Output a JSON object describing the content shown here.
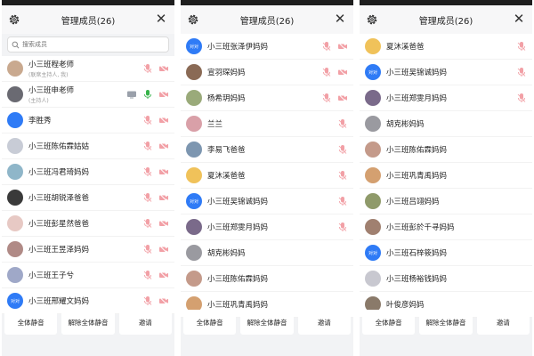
{
  "colors": {
    "muted_mic": "#f2a0a6",
    "active_mic": "#37b34a",
    "camera_off": "#f2a0a6",
    "brand_blue": "#2f7bf6"
  },
  "panels": [
    {
      "title": "管理成员(26)",
      "search_placeholder": "搜索成员",
      "members": [
        {
          "name": "小三班程老师",
          "sub": "(联席主持人, 我)",
          "avatar": "photo",
          "avatar_color": "#c9a98f",
          "mic": "muted",
          "cam": "off"
        },
        {
          "name": "小三班申老师",
          "sub": "(主持人)",
          "avatar": "photo",
          "avatar_color": "#6a6a72",
          "mic": "active",
          "cam": "off",
          "screen": "screen-share-icon"
        },
        {
          "name": "李胜秀",
          "avatar": "text",
          "avatar_text": "",
          "avatar_color": "#2f7bf6",
          "mic": "muted",
          "cam": "off"
        },
        {
          "name": "小三班陈佑霖姑姑",
          "avatar": "photo",
          "avatar_color": "#c8ccd6",
          "mic": "muted",
          "cam": "off"
        },
        {
          "name": "小三班冯君琦妈妈",
          "avatar": "photo",
          "avatar_color": "#8fb6c9",
          "mic": "muted",
          "cam": "off"
        },
        {
          "name": "小三班胡锐泽爸爸",
          "avatar": "photo",
          "avatar_color": "#3a3a3a",
          "mic": "muted",
          "cam": "off"
        },
        {
          "name": "小三班彭星然爸爸",
          "avatar": "photo",
          "avatar_color": "#e7c9c4",
          "mic": "muted",
          "cam": "off"
        },
        {
          "name": "小三班王昱泽妈妈",
          "avatar": "photo",
          "avatar_color": "#b08a86",
          "mic": "muted",
          "cam": "off"
        },
        {
          "name": "小三班王子兮",
          "avatar": "photo",
          "avatar_color": "#9fa8c8",
          "mic": "muted",
          "cam": "off"
        },
        {
          "name": "小三班邢耀文妈妈",
          "avatar": "text",
          "avatar_text": "对对",
          "avatar_color": "#2f7bf6",
          "mic": "muted",
          "cam": "off"
        }
      ],
      "buttons": [
        "全体静音",
        "解除全体静音",
        "邀请"
      ]
    },
    {
      "title": "管理成员(26)",
      "members": [
        {
          "name": "小三班张泽伊妈妈",
          "avatar": "text",
          "avatar_text": "对对",
          "avatar_color": "#2f7bf6",
          "mic": "muted",
          "cam": "off"
        },
        {
          "name": "宣羽琛妈妈",
          "avatar": "photo",
          "avatar_color": "#8a6a55",
          "mic": "muted",
          "cam": "off"
        },
        {
          "name": "杨希玥妈妈",
          "avatar": "photo",
          "avatar_color": "#9aaa7a",
          "mic": "muted",
          "cam": "off"
        },
        {
          "name": "兰兰",
          "avatar": "photo",
          "avatar_color": "#d9a0a8",
          "mic": "muted"
        },
        {
          "name": "李易飞爸爸",
          "avatar": "photo",
          "avatar_color": "#7d96b0",
          "mic": "muted"
        },
        {
          "name": "夏沐溪爸爸",
          "avatar": "photo",
          "avatar_color": "#f0c25a",
          "mic": "muted"
        },
        {
          "name": "小三班吴锦诚妈妈",
          "avatar": "text",
          "avatar_text": "对对",
          "avatar_color": "#2f7bf6",
          "mic": "muted"
        },
        {
          "name": "小三班郑雯月妈妈",
          "avatar": "photo",
          "avatar_color": "#7a6a8a",
          "mic": "muted"
        },
        {
          "name": "胡克彬妈妈",
          "avatar": "photo",
          "avatar_color": "#9a9aa0"
        },
        {
          "name": "小三班陈佑霖妈妈",
          "avatar": "photo",
          "avatar_color": "#c49a8a"
        },
        {
          "name": "小三班巩青禹妈妈",
          "avatar": "photo",
          "avatar_color": "#d4a070"
        }
      ],
      "buttons": [
        "全体静音",
        "解除全体静音",
        "邀请"
      ]
    },
    {
      "title": "管理成员(26)",
      "members": [
        {
          "name": "夏沐溪爸爸",
          "avatar": "photo",
          "avatar_color": "#f0c25a",
          "mic": "muted"
        },
        {
          "name": "小三班吴锦诚妈妈",
          "avatar": "text",
          "avatar_text": "对对",
          "avatar_color": "#2f7bf6",
          "mic": "muted"
        },
        {
          "name": "小三班郑雯月妈妈",
          "avatar": "photo",
          "avatar_color": "#7a6a8a",
          "mic": "muted"
        },
        {
          "name": "胡克彬妈妈",
          "avatar": "photo",
          "avatar_color": "#9a9aa0"
        },
        {
          "name": "小三班陈佑霖妈妈",
          "avatar": "photo",
          "avatar_color": "#c49a8a"
        },
        {
          "name": "小三班巩青禹妈妈",
          "avatar": "photo",
          "avatar_color": "#d4a070"
        },
        {
          "name": "小三班吕翊妈妈",
          "avatar": "photo",
          "avatar_color": "#8f9a6a"
        },
        {
          "name": "小三班彭於千寻妈妈",
          "avatar": "photo",
          "avatar_color": "#a08070"
        },
        {
          "name": "小三班石梓筱妈妈",
          "avatar": "text",
          "avatar_text": "对对",
          "avatar_color": "#2f7bf6"
        },
        {
          "name": "小三班杨裕钱妈妈",
          "avatar": "photo",
          "avatar_color": "#c8c8d0"
        },
        {
          "name": "叶俊彦妈妈",
          "avatar": "photo",
          "avatar_color": "#8a7a6a"
        }
      ],
      "buttons": [
        "全体静音",
        "解除全体静音",
        "邀请"
      ]
    }
  ]
}
